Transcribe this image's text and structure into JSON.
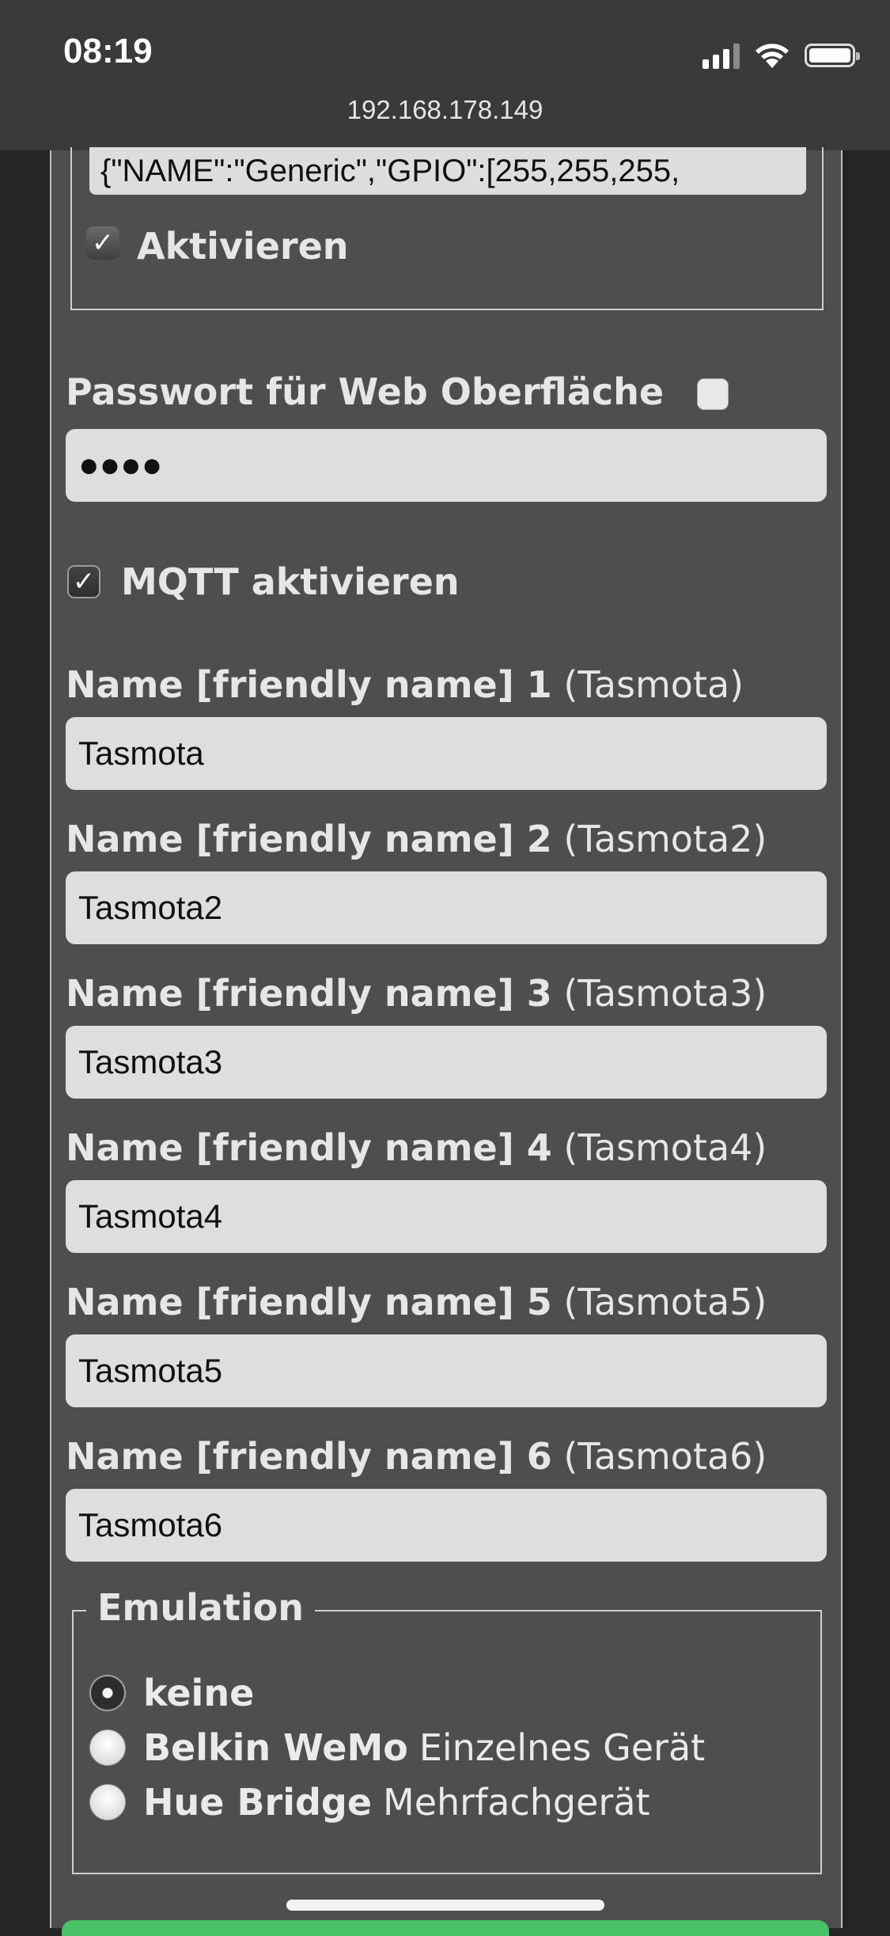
{
  "status_bar": {
    "time": "08:19"
  },
  "browser": {
    "url": "192.168.178.149"
  },
  "template": {
    "value": "{\"NAME\":\"Generic\",\"GPIO\":[255,255,255,",
    "activate_label": "Aktivieren",
    "activate_checked": true
  },
  "web_password": {
    "label": "Passwort für Web Oberfläche",
    "value": "●●●●",
    "show_checked": false
  },
  "mqtt": {
    "label": "MQTT aktivieren",
    "checked": true
  },
  "friendly_names": [
    {
      "label": "Name [friendly name] 1",
      "hint": "(Tasmota)",
      "value": "Tasmota"
    },
    {
      "label": "Name [friendly name] 2",
      "hint": "(Tasmota2)",
      "value": "Tasmota2"
    },
    {
      "label": "Name [friendly name] 3",
      "hint": "(Tasmota3)",
      "value": "Tasmota3"
    },
    {
      "label": "Name [friendly name] 4",
      "hint": "(Tasmota4)",
      "value": "Tasmota4"
    },
    {
      "label": "Name [friendly name] 5",
      "hint": "(Tasmota5)",
      "value": "Tasmota5"
    },
    {
      "label": "Name [friendly name] 6",
      "hint": "(Tasmota6)",
      "value": "Tasmota6"
    }
  ],
  "emulation": {
    "legend": "Emulation",
    "options": [
      {
        "name": "keine",
        "desc": "",
        "selected": true
      },
      {
        "name": "Belkin WeMo",
        "desc": "Einzelnes Gerät",
        "selected": false
      },
      {
        "name": "Hue Bridge",
        "desc": "Mehrfachgerät",
        "selected": false
      }
    ]
  }
}
